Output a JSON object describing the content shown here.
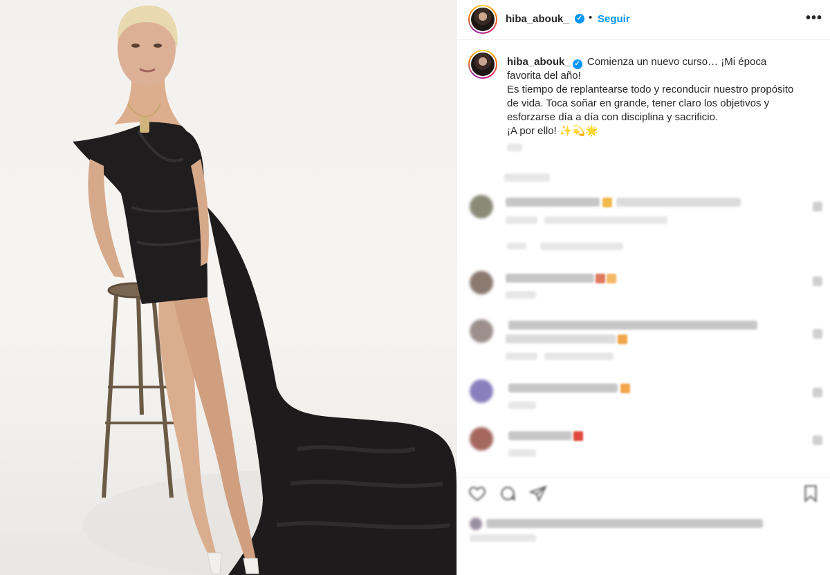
{
  "post": {
    "username": "hiba_abouk_",
    "verified_mark": "✓",
    "dot": "•",
    "follow_label": "Seguir",
    "more_label": "•••",
    "avatar_icon": "profile-photo",
    "caption_line1": "Comienza un nuevo curso… ¡Mi época favorita del año!",
    "caption_line2": "Es tiempo de replantearse todo y reconducir nuestro propósito de vida. Toca soñar en grande, tener claro los objetivos y esforzarse día a día con disciplina y sacrificio.",
    "caption_line3": "¡A por ello! ✨💫🌟"
  },
  "colors": {
    "accent": "#0095f6",
    "text": "#262626",
    "border": "#efefef"
  },
  "comments": [
    {
      "avatar_color": "#8a8a78"
    },
    {
      "avatar_color": "#8b7a70"
    },
    {
      "avatar_color": "#9c8f8c"
    },
    {
      "avatar_color": "#8a7fbe"
    },
    {
      "avatar_color": "#a5685f"
    }
  ],
  "icons": [
    "heart-icon",
    "comment-icon",
    "share-icon",
    "bookmark-icon"
  ]
}
